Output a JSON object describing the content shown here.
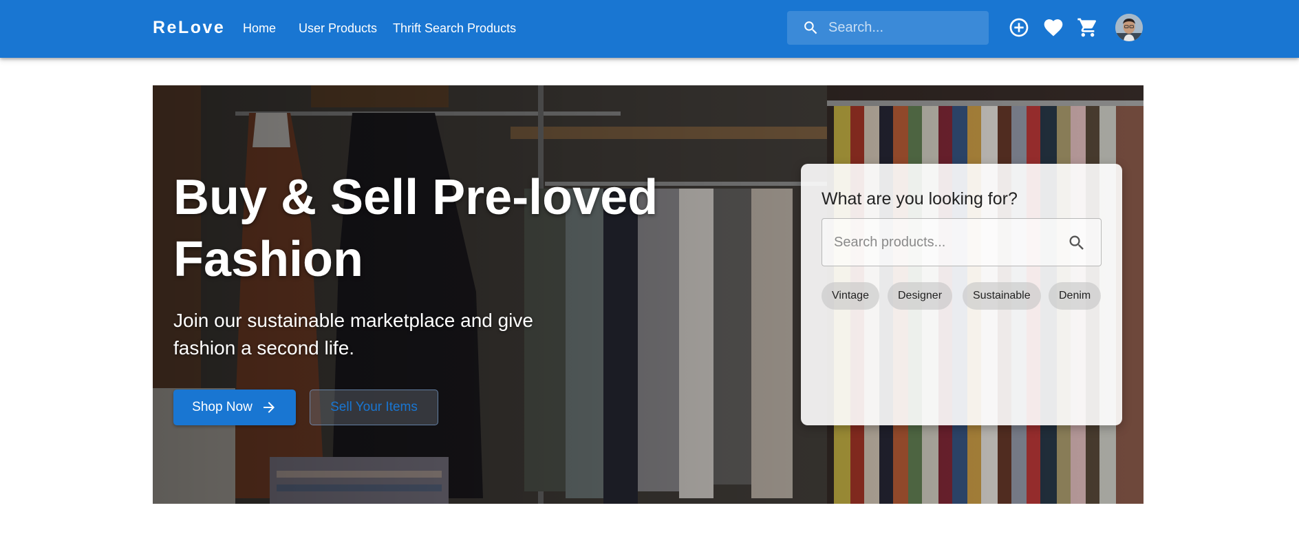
{
  "header": {
    "brand": "ReLove",
    "nav": [
      "Home",
      "User Products",
      "Thrift Search Products"
    ],
    "search_placeholder": "Search..."
  },
  "icons": {
    "search": "search-icon",
    "add": "add-circle-icon",
    "favorite": "heart-icon",
    "cart": "cart-icon",
    "avatar": "user-avatar",
    "arrow": "arrow-right-icon"
  },
  "colors": {
    "primary": "#1976d2",
    "white": "#ffffff"
  },
  "hero": {
    "title_line1": "Buy & Sell Pre-loved",
    "title_line2": "Fashion",
    "subtitle_line1": "Join our sustainable marketplace and give",
    "subtitle_line2": "fashion a second life.",
    "primary_button": "Shop Now",
    "secondary_button": "Sell Your Items"
  },
  "search_card": {
    "heading": "What are you looking for?",
    "placeholder": "Search products...",
    "chips": [
      "Vintage",
      "Designer",
      "Sustainable",
      "Denim"
    ]
  }
}
